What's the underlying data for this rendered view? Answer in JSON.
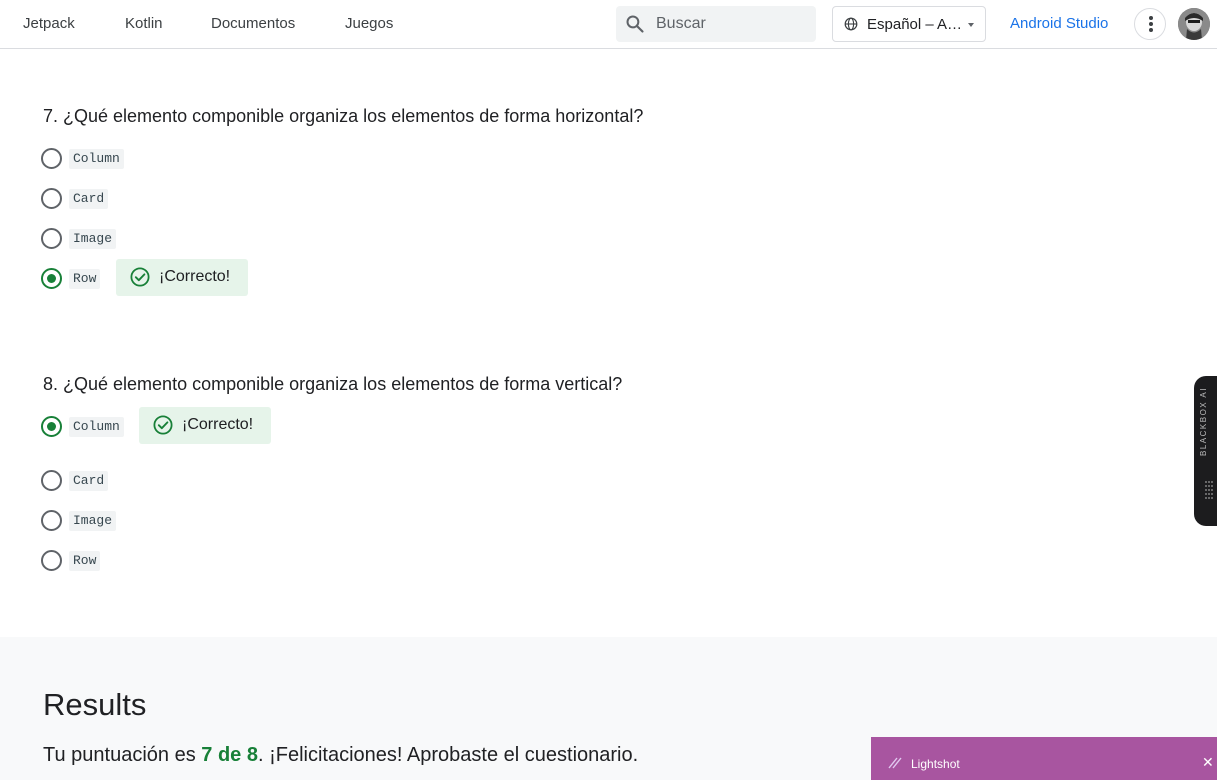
{
  "nav": {
    "links": [
      "Jetpack",
      "Kotlin",
      "Documentos",
      "Juegos"
    ],
    "search_placeholder": "Buscar",
    "language": "Español – A…",
    "studio_link": "Android Studio"
  },
  "questions": [
    {
      "title": "7. ¿Qué elemento componible organiza los elementos de forma horizontal?",
      "options": [
        "Column",
        "Card",
        "Image",
        "Row"
      ],
      "selected": 3,
      "feedback": "¡Correcto!"
    },
    {
      "title": "8. ¿Qué elemento componible organiza los elementos de forma vertical?",
      "options": [
        "Column",
        "Card",
        "Image",
        "Row"
      ],
      "selected": 0,
      "feedback": "¡Correcto!"
    }
  ],
  "results": {
    "title": "Results",
    "prefix": "Tu puntuación es ",
    "score": "7 de 8",
    "suffix": ". ¡Felicitaciones! Aprobaste el cuestionario."
  },
  "overlays": {
    "blackbox_label": "BLACKBOX AI",
    "lightshot_label": "Lightshot",
    "lightshot_close": "✕"
  },
  "colors": {
    "accent_blue": "#1a73e8",
    "correct_green": "#188038",
    "feedback_bg": "#e6f4ea",
    "lightshot_purple": "#a855a0"
  }
}
